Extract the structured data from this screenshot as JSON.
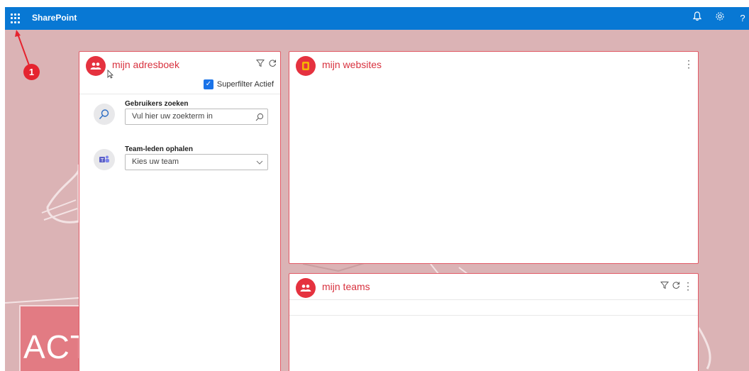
{
  "topbar": {
    "brand": "SharePoint",
    "notify_icon": "bell-icon",
    "settings_icon": "gear-icon",
    "help_label": "?"
  },
  "annotation": {
    "label": "1"
  },
  "background": {
    "logo_text": "ACTA"
  },
  "adresboek": {
    "title": "mijn adresboek",
    "superfilter_label": "Superfilter Actief",
    "superfilter_checked": true,
    "search": {
      "label": "Gebruikers zoeken",
      "placeholder": "Vul hier uw zoekterm in"
    },
    "team": {
      "label": "Team-leden ophalen",
      "selected": "Kies uw team"
    }
  },
  "websites": {
    "title": "mijn websites"
  },
  "teams": {
    "title": "mijn teams"
  },
  "colors": {
    "topbar": "#0878d4",
    "accent": "#e5323f",
    "background": "#dbb3b5"
  }
}
